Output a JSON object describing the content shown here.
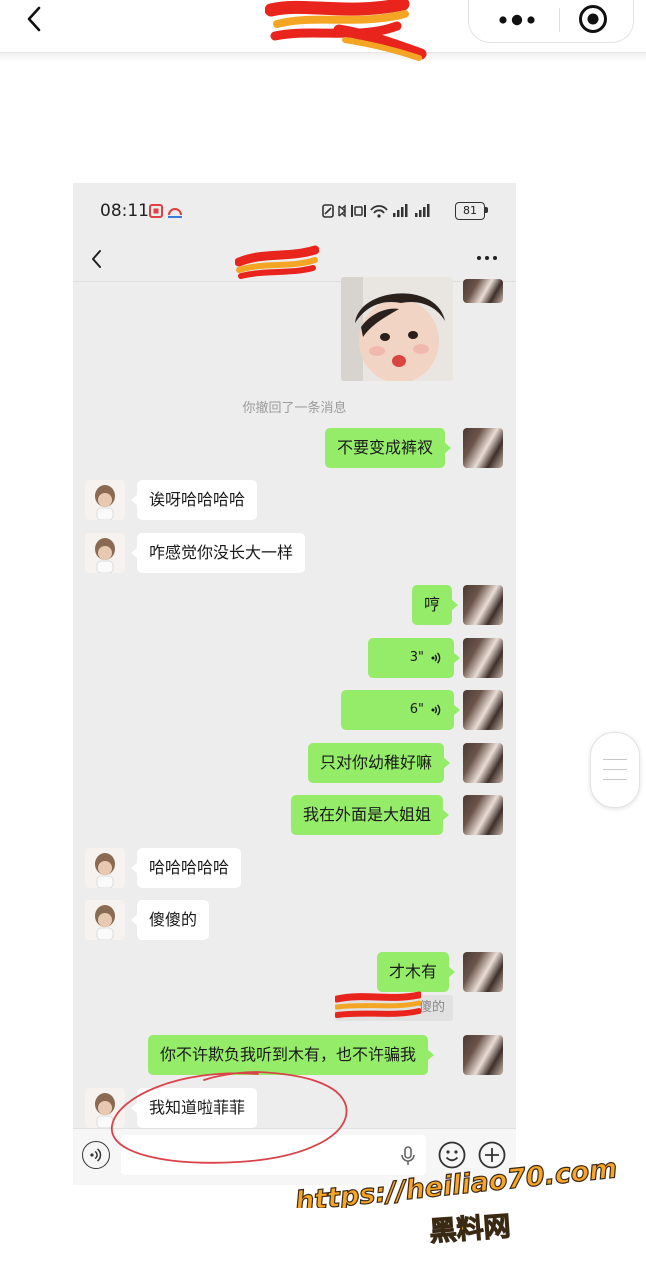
{
  "status_bar": {
    "time": "08:11",
    "battery": "81"
  },
  "nav": {
    "title": ""
  },
  "messages": [
    {
      "id": "recall",
      "type": "system",
      "text": "你撤回了一条消息"
    },
    {
      "id": "m1",
      "side": "me",
      "type": "text",
      "text": "不要变成裤衩"
    },
    {
      "id": "m2",
      "side": "other",
      "type": "text",
      "text": "诶呀哈哈哈哈"
    },
    {
      "id": "m3",
      "side": "other",
      "type": "text",
      "text": "咋感觉你没长大一样"
    },
    {
      "id": "m4",
      "side": "me",
      "type": "text",
      "text": "哼"
    },
    {
      "id": "m5",
      "side": "me",
      "type": "voice",
      "duration": "3\""
    },
    {
      "id": "m6",
      "side": "me",
      "type": "voice",
      "duration": "6\""
    },
    {
      "id": "m7",
      "side": "me",
      "type": "text",
      "text": "只对你幼稚好嘛"
    },
    {
      "id": "m8",
      "side": "me",
      "type": "text",
      "text": "我在外面是大姐姐"
    },
    {
      "id": "m9",
      "side": "other",
      "type": "text",
      "text": "哈哈哈哈哈"
    },
    {
      "id": "m10",
      "side": "other",
      "type": "text",
      "text": "傻傻的"
    },
    {
      "id": "m11",
      "side": "me",
      "type": "text",
      "text": "才木有"
    },
    {
      "id": "m11q",
      "type": "quote",
      "text": "傻的"
    },
    {
      "id": "m12",
      "side": "me",
      "type": "text",
      "text": "你不许欺负我听到木有，也不许骗我"
    },
    {
      "id": "m13",
      "side": "other",
      "type": "text",
      "text": "我知道啦菲菲"
    }
  ],
  "input": {
    "placeholder": ""
  },
  "watermark": {
    "url": "https://heiliao70.com",
    "name": "黑料网"
  },
  "icons": {
    "top_back": "back-arrow-icon",
    "menu": "more-dots-icon",
    "close": "target-circle-icon",
    "voice": "voice-input-icon",
    "mic": "microphone-icon",
    "emoji": "emoji-icon",
    "plus": "plus-icon"
  },
  "colors": {
    "bubble_me": "#95ec69",
    "bubble_other": "#ffffff",
    "chat_bg": "#ededed",
    "redaction_red": "#e8241c",
    "redaction_orange": "#f5a524",
    "watermark_orange": "#f7a428",
    "circle_mark": "#d9434a"
  }
}
